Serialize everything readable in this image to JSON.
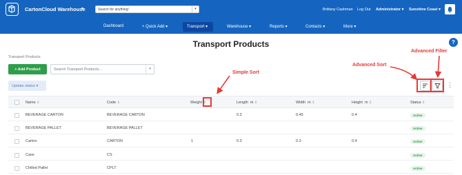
{
  "topbar": {
    "app_name": "CartonCloud Warehouse",
    "app_caret": "▾",
    "search_placeholder": "Search for anything!",
    "search_caret": "▾",
    "user_name": "Brittany Cashman",
    "logout_label": "Log Out",
    "role_label": "Administrator ▾",
    "region_label": "Sunshine Coast ▾",
    "bell_icon": "bell-icon",
    "brand_color": "#1565c0"
  },
  "nav": {
    "items": [
      {
        "label": "Dashboard"
      },
      {
        "label": "+ Quick Add ▾"
      },
      {
        "label": "Transport ▾"
      },
      {
        "label": "Warehouse ▾"
      },
      {
        "label": "Reports ▾"
      },
      {
        "label": "Contacts ▾"
      },
      {
        "label": "More ▾"
      }
    ],
    "active_index": 2
  },
  "page": {
    "title": "Transport Products",
    "help_label": "?",
    "breadcrumb": "Transport Products",
    "add_button_label": "+ Add Product",
    "add_button_color": "#2e9e4a",
    "search_placeholder": "Search Transport Products...",
    "search_caret": "▾",
    "update_status_label": "Update status ▾",
    "kebab": "⋮"
  },
  "annotations": {
    "advanced_filter": "Advanced Filter",
    "advanced_sort": "Advanced Sort",
    "simple_sort": "Simple Sort",
    "color": "#e53935"
  },
  "table": {
    "headers": [
      "Name",
      "Code",
      "Weight",
      "Length",
      "Width",
      "Height",
      "Status"
    ],
    "unit": "m",
    "sort_glyph": "⇕",
    "rows": [
      {
        "name": "BEVERAGE CARTON",
        "code": "BEVERAGE CARTON",
        "weight": "",
        "length": "0.3",
        "width": "0.45",
        "height": "0.4",
        "status": "Active"
      },
      {
        "name": "BEVERAGE PALLET",
        "code": "BEVERAGE PALLET",
        "weight": "",
        "length": "",
        "width": "",
        "height": "",
        "status": "Active"
      },
      {
        "name": "Carton",
        "code": "CARTON",
        "weight": "1",
        "length": "0.3",
        "width": "0.3",
        "height": "0.4",
        "status": "Active"
      },
      {
        "name": "Case",
        "code": "CS",
        "weight": "",
        "length": "",
        "width": "",
        "height": "",
        "status": "Active"
      },
      {
        "name": "Chilled Pallet",
        "code": "CPLT",
        "weight": "",
        "length": "",
        "width": "",
        "height": "",
        "status": "Active"
      }
    ]
  }
}
